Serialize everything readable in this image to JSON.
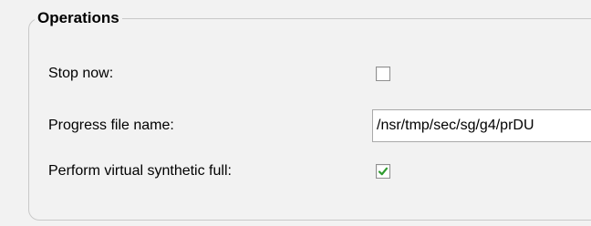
{
  "group": {
    "title": "Operations"
  },
  "rows": {
    "stop_now": {
      "label": "Stop now:",
      "checked": false
    },
    "progress_file": {
      "label": "Progress file name:",
      "value": "/nsr/tmp/sec/sg/g4/prDU"
    },
    "virtual_synthetic": {
      "label": "Perform virtual synthetic full:",
      "checked": true
    }
  },
  "colors": {
    "check_mark": "#2e9b2e",
    "border": "#c9c9c9",
    "background": "#f2f2f2"
  }
}
